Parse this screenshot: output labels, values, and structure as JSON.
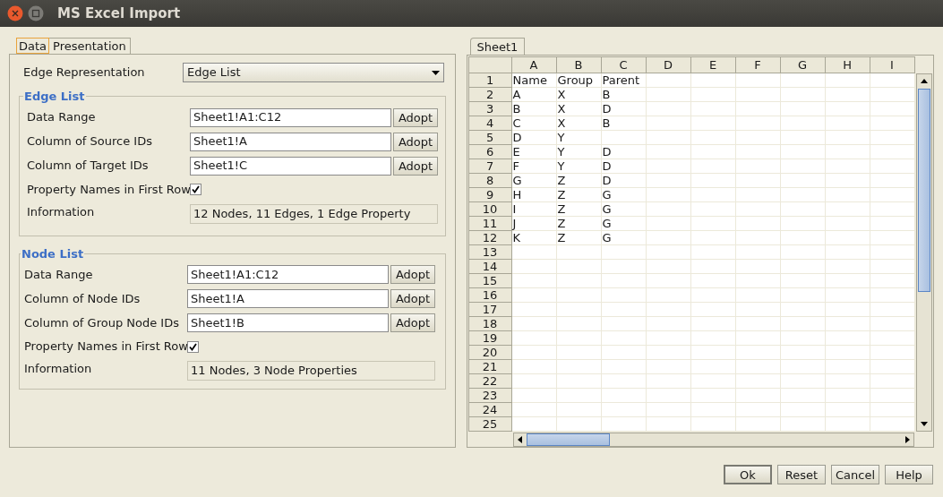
{
  "window": {
    "title": "MS Excel Import"
  },
  "tabs": [
    {
      "label": "Data",
      "selected": true
    },
    {
      "label": "Presentation",
      "selected": false
    }
  ],
  "edge_representation": {
    "label": "Edge Representation",
    "value": "Edge List"
  },
  "sections": [
    {
      "title": "Edge List",
      "rows": [
        {
          "kind": "field",
          "label": "Data Range",
          "value": "Sheet1!A1:C12",
          "button": "Adopt"
        },
        {
          "kind": "field",
          "label": "Column of Source IDs",
          "value": "Sheet1!A",
          "button": "Adopt"
        },
        {
          "kind": "field",
          "label": "Column of Target IDs",
          "value": "Sheet1!C",
          "button": "Adopt"
        },
        {
          "kind": "checkbox",
          "label": "Property Names in First Row",
          "checked": true
        },
        {
          "kind": "info",
          "label": "Information",
          "value": "12 Nodes, 11 Edges, 1 Edge Property"
        }
      ]
    },
    {
      "title": "Node List",
      "rows": [
        {
          "kind": "field",
          "label": "Data Range",
          "value": "Sheet1!A1:C12",
          "button": "Adopt"
        },
        {
          "kind": "field",
          "label": "Column of Node IDs",
          "value": "Sheet1!A",
          "button": "Adopt"
        },
        {
          "kind": "field",
          "label": "Column of Group Node IDs",
          "value": "Sheet1!B",
          "button": "Adopt"
        },
        {
          "kind": "checkbox",
          "label": "Property Names in First Row",
          "checked": true
        },
        {
          "kind": "info",
          "label": "Information",
          "value": "11 Nodes, 3 Node Properties"
        }
      ]
    }
  ],
  "sheet_tabs": [
    {
      "label": "Sheet1",
      "selected": true
    }
  ],
  "sheet": {
    "columns": [
      "A",
      "B",
      "C",
      "D",
      "E",
      "F",
      "G",
      "H",
      "I"
    ],
    "rows": [
      {
        "number": "1",
        "cells": [
          "Name",
          "Group",
          "Parent"
        ]
      },
      {
        "number": "2",
        "cells": [
          "A",
          "X",
          "B"
        ]
      },
      {
        "number": "3",
        "cells": [
          "B",
          "X",
          "D"
        ]
      },
      {
        "number": "4",
        "cells": [
          "C",
          "X",
          "B"
        ]
      },
      {
        "number": "5",
        "cells": [
          "D",
          "Y"
        ]
      },
      {
        "number": "6",
        "cells": [
          "E",
          "Y",
          "D"
        ]
      },
      {
        "number": "7",
        "cells": [
          "F",
          "Y",
          "D"
        ]
      },
      {
        "number": "8",
        "cells": [
          "G",
          "Z",
          "D"
        ]
      },
      {
        "number": "9",
        "cells": [
          "H",
          "Z",
          "G"
        ]
      },
      {
        "number": "10",
        "cells": [
          "I",
          "Z",
          "G"
        ]
      },
      {
        "number": "11",
        "cells": [
          "J",
          "Z",
          "G"
        ]
      },
      {
        "number": "12",
        "cells": [
          "K",
          "Z",
          "G"
        ]
      },
      {
        "number": "13"
      },
      {
        "number": "14"
      },
      {
        "number": "15"
      },
      {
        "number": "16"
      },
      {
        "number": "17"
      },
      {
        "number": "18"
      },
      {
        "number": "19"
      },
      {
        "number": "20"
      },
      {
        "number": "21"
      },
      {
        "number": "22"
      },
      {
        "number": "23"
      },
      {
        "number": "24"
      },
      {
        "number": "25"
      }
    ]
  },
  "buttons": [
    {
      "label": "Ok",
      "default": true
    },
    {
      "label": "Reset",
      "default": false
    },
    {
      "label": "Cancel",
      "default": false
    },
    {
      "label": "Help",
      "default": false
    }
  ]
}
